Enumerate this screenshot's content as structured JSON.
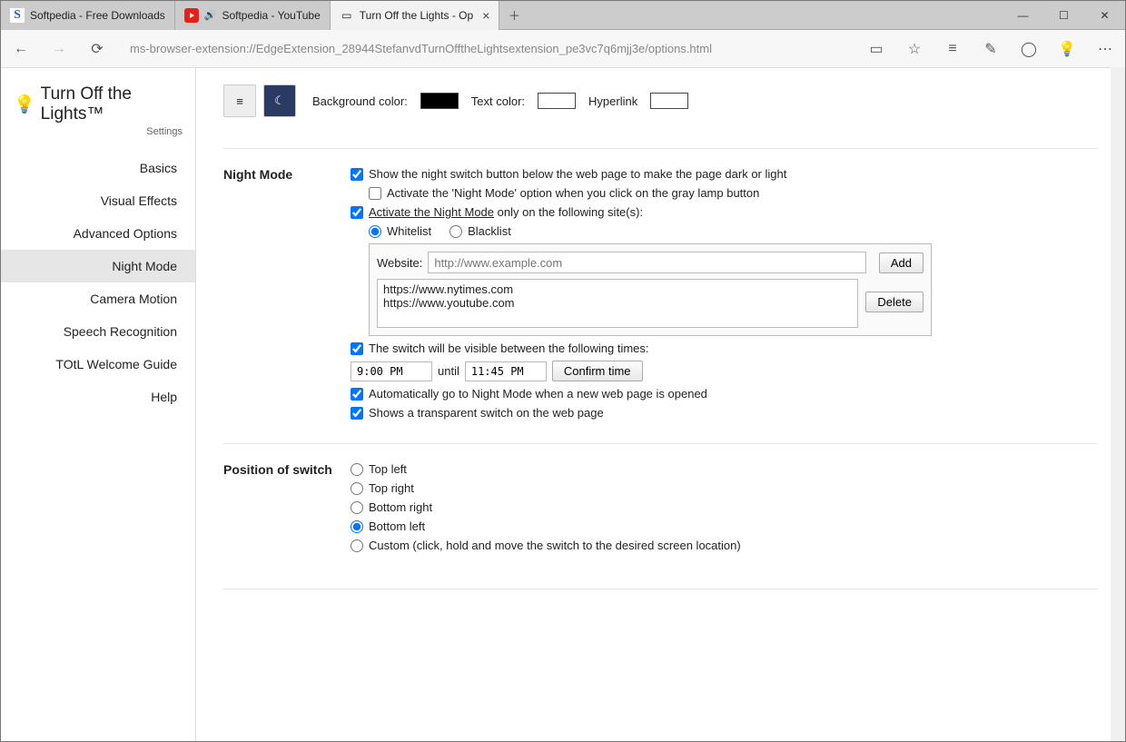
{
  "tabs": [
    {
      "title": "Softpedia - Free Downloads"
    },
    {
      "title": "Softpedia - YouTube"
    },
    {
      "title": "Turn Off the Lights - Op"
    }
  ],
  "address": "ms-browser-extension://EdgeExtension_28944StefanvdTurnOfftheLightsextension_pe3vc7q6mjj3e/options.html",
  "sidebar": {
    "title": "Turn Off the Lights™",
    "subtitle": "Settings",
    "items": [
      "Basics",
      "Visual Effects",
      "Advanced Options",
      "Night Mode",
      "Camera Motion",
      "Speech Recognition",
      "TOtL Welcome Guide",
      "Help"
    ]
  },
  "topbar": {
    "bg_label": "Background color:",
    "text_label": "Text color:",
    "link_label": "Hyperlink",
    "bg_swatch": "#000000",
    "text_swatch": "#ffffff",
    "link_swatch": "#ffffff"
  },
  "night": {
    "section_label": "Night Mode",
    "show_switch": "Show the night switch button below the web page to make the page dark or light",
    "activate_click": "Activate the 'Night Mode' option when you click on the gray lamp button",
    "activate_sites_a": "Activate the Night Mode",
    "activate_sites_b": " only on the following site(s):",
    "whitelist": "Whitelist",
    "blacklist": "Blacklist",
    "website_label": "Website:",
    "website_placeholder": "http://www.example.com",
    "add_btn": "Add",
    "delete_btn": "Delete",
    "sites": "https://www.nytimes.com\nhttps://www.youtube.com",
    "visible_times": "The switch will be visible between the following times:",
    "time_from": "9:00 PM",
    "time_until_label": "until",
    "time_to": "11:45 PM",
    "confirm_btn": "Confirm time",
    "auto_night": "Automatically go to Night Mode when a new web page is opened",
    "transparent_switch": "Shows a transparent switch on the web page"
  },
  "position": {
    "section_label": "Position of switch",
    "options": [
      "Top left",
      "Top right",
      "Bottom right",
      "Bottom left",
      "Custom (click, hold and move the switch to the desired screen location)"
    ]
  }
}
